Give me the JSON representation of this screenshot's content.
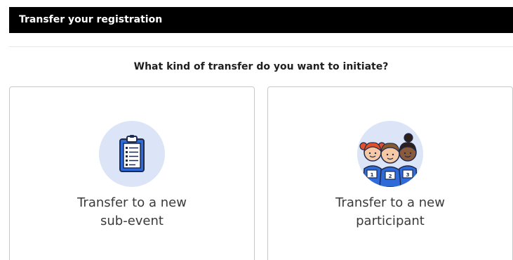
{
  "header": {
    "title": "Transfer your registration"
  },
  "prompt": {
    "question": "What kind of transfer do you want to initiate?"
  },
  "options": [
    {
      "label_line1": "Transfer to a new",
      "label_line2": "sub-event",
      "icon": "clipboard-icon"
    },
    {
      "label_line1": "Transfer to a new",
      "label_line2": "participant",
      "icon": "participants-icon",
      "bib_numbers": [
        "1",
        "2",
        "3"
      ]
    }
  ],
  "colors": {
    "header_bg": "#000000",
    "icon_circle_bg": "#dbe5f7",
    "accent_blue": "#2f6bd8",
    "outline": "#1d2a4d"
  }
}
